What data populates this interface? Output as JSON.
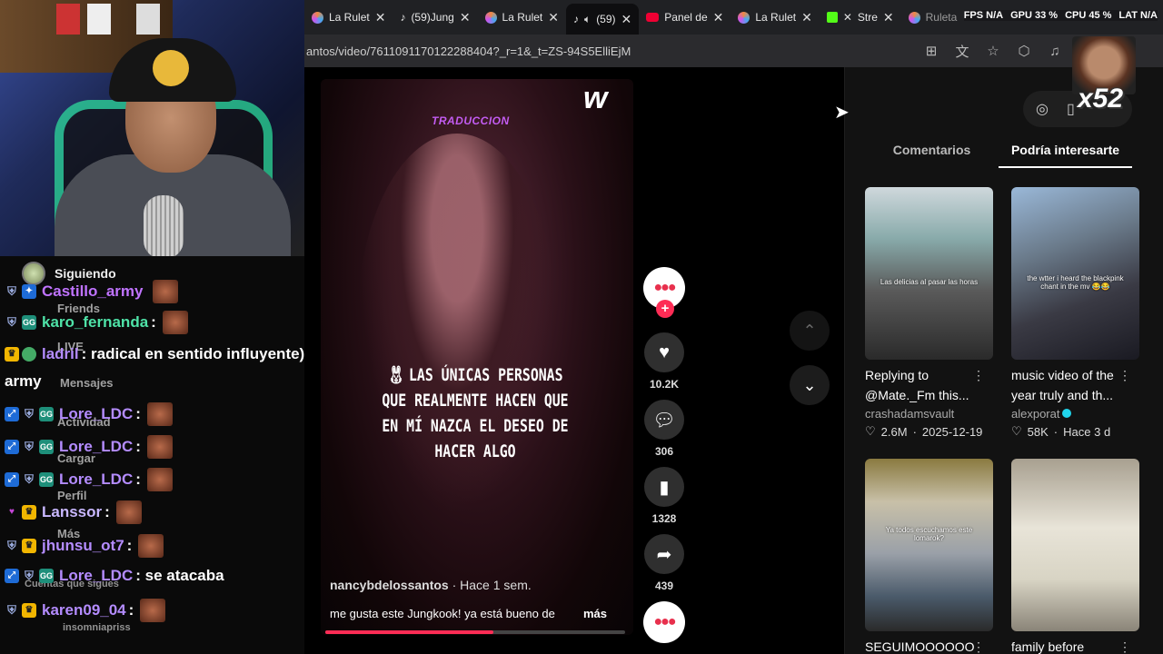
{
  "browser": {
    "tabs": [
      {
        "label": "La Rulet",
        "icon": "roulette-icon"
      },
      {
        "label": "(59)Jung",
        "icon": "tiktok-icon"
      },
      {
        "label": "La Rulet",
        "icon": "roulette-icon"
      },
      {
        "label": "(59)",
        "icon": "tiktok-icon",
        "active": true
      },
      {
        "label": "Panel de",
        "icon": "youtube-icon"
      },
      {
        "label": "La Rulet",
        "icon": "roulette-icon"
      },
      {
        "label": "Stre",
        "icon": "kick-icon"
      },
      {
        "label": "Ruleta",
        "icon": "roulette-icon"
      }
    ],
    "url": "antos/video/7611091170122288404?_r=1&_t=ZS-94S5ElliEjM",
    "system_stats": [
      "FPS N/A",
      "GPU 33 %",
      "CPU 45 %",
      "LAT N/A"
    ]
  },
  "overlay": {
    "multiplier": "x52"
  },
  "video": {
    "header_label": "TRADUCCION",
    "subtitle": "LAS ÚNICAS PERSONAS QUE REALMENTE HACEN QUE EN MÍ NAZCA EL DESEO DE HACER ALGO",
    "author": "nancybdelossantos",
    "posted": "Hace 1 sem.",
    "caption": "me gusta este Jungkook! ya está bueno de",
    "more_label": "más",
    "progress": 0.56,
    "likes": "10.2K",
    "comments": "306",
    "saves": "1328",
    "shares": "439"
  },
  "side_panel": {
    "tabs": [
      "Comentarios",
      "Podría interesarte"
    ],
    "selected_tab": 1,
    "cards": [
      {
        "title": "Replying to @Mate._Fm this...",
        "author": "crashadamsvault",
        "likes": "2.6M",
        "date": "2025-12-19",
        "overlay": "Las delicias al pasar las horas",
        "verified": false
      },
      {
        "title": "music video of the year truly and th...",
        "author": "alexporat",
        "likes": "58K",
        "date": "Hace 3 d",
        "overlay": "the wtter i heard the blackpink chant in the mv 😂😂",
        "verified": true
      },
      {
        "title": "SEGUIMOOOOOO",
        "author": "",
        "likes": "",
        "date": "",
        "overlay": "Ya todos escuchamos este lomarok?",
        "verified": false
      },
      {
        "title": "family before",
        "author": "",
        "likes": "",
        "date": "",
        "overlay": "",
        "verified": false
      }
    ]
  },
  "chat": {
    "following_label": "Siguiendo",
    "ghost_menu": [
      "Friends",
      "LIVE",
      "Mensajes",
      "Actividad",
      "Cargar",
      "Perfil",
      "Más",
      "Cuentas que sigues",
      "insomniapriss"
    ],
    "messages": [
      {
        "user": "Castillo_army",
        "text": "",
        "color": "#c073ff"
      },
      {
        "user": "karo_fernanda",
        "text": ":",
        "color": "#4fe3a8"
      },
      {
        "user": "ladril",
        "text": ": radical en sentido influyente)?",
        "color": "#b48cff"
      },
      {
        "user": "army",
        "text": "",
        "color": "#ffffff"
      },
      {
        "user": "Lore_LDC",
        "text": ":",
        "color": "#b48cff"
      },
      {
        "user": "Lore_LDC",
        "text": ":",
        "color": "#b48cff"
      },
      {
        "user": "Lore_LDC",
        "text": ":",
        "color": "#b48cff"
      },
      {
        "user": "Lanssor",
        "text": ":",
        "color": "#c9b8ff"
      },
      {
        "user": "jhunsu_ot7",
        "text": ":",
        "color": "#b48cff"
      },
      {
        "user": "Lore_LDC",
        "text": ": se atacaba",
        "color": "#b48cff"
      },
      {
        "user": "karen09_04",
        "text": ":",
        "color": "#b48cff"
      }
    ]
  }
}
